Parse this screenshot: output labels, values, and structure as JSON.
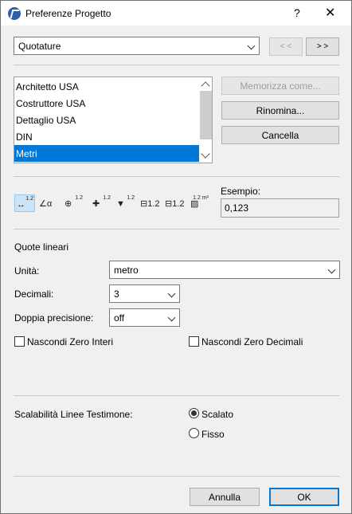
{
  "window": {
    "title": "Preferenze Progetto",
    "help_label": "?",
    "close_label": "✕"
  },
  "category_select": {
    "value": "Quotature"
  },
  "nav": {
    "prev_label": "< <",
    "next_label": "> >"
  },
  "presets": {
    "items": [
      "Architetto USA",
      "Costruttore USA",
      "Dettaglio USA",
      "DIN",
      "Metri"
    ],
    "selected": "Metri"
  },
  "preset_buttons": {
    "store_as": "Memorizza come...",
    "rename": "Rinomina...",
    "delete": "Cancella"
  },
  "dimension_types": {
    "icons": [
      {
        "name": "linear-dimension-icon",
        "sup": "1.2",
        "glyph": "↔"
      },
      {
        "name": "angular-dimension-icon",
        "sup": "",
        "glyph": "∠α"
      },
      {
        "name": "radial-dimension-icon",
        "sup": "1.2",
        "glyph": "⊕"
      },
      {
        "name": "level-dimension-icon",
        "sup": "1.2",
        "glyph": "✚"
      },
      {
        "name": "elevation-dimension-icon",
        "sup": "1.2",
        "glyph": "▼"
      },
      {
        "name": "door-window-dimension-icon",
        "sup": "",
        "glyph": "⊟1.2"
      },
      {
        "name": "sill-height-dimension-icon",
        "sup": "",
        "glyph": "⊟1.2"
      },
      {
        "name": "area-dimension-icon",
        "sup": "1.2 m²",
        "glyph": "▨"
      }
    ],
    "selected_index": 0
  },
  "example": {
    "label": "Esempio:",
    "value": "0,123"
  },
  "linear": {
    "section_title": "Quote lineari",
    "unit_label": "Unità:",
    "unit_value": "metro",
    "decimals_label": "Decimali:",
    "decimals_value": "3",
    "double_precision_label": "Doppia precisione:",
    "double_precision_value": "off",
    "hide_zero_integers_label": "Nascondi Zero Interi",
    "hide_zero_decimals_label": "Nascondi Zero Decimali"
  },
  "witness": {
    "label": "Scalabilità Linee Testimone:",
    "options": [
      "Scalato",
      "Fisso"
    ],
    "selected": "Scalato"
  },
  "footer": {
    "cancel_label": "Annulla",
    "ok_label": "OK"
  }
}
